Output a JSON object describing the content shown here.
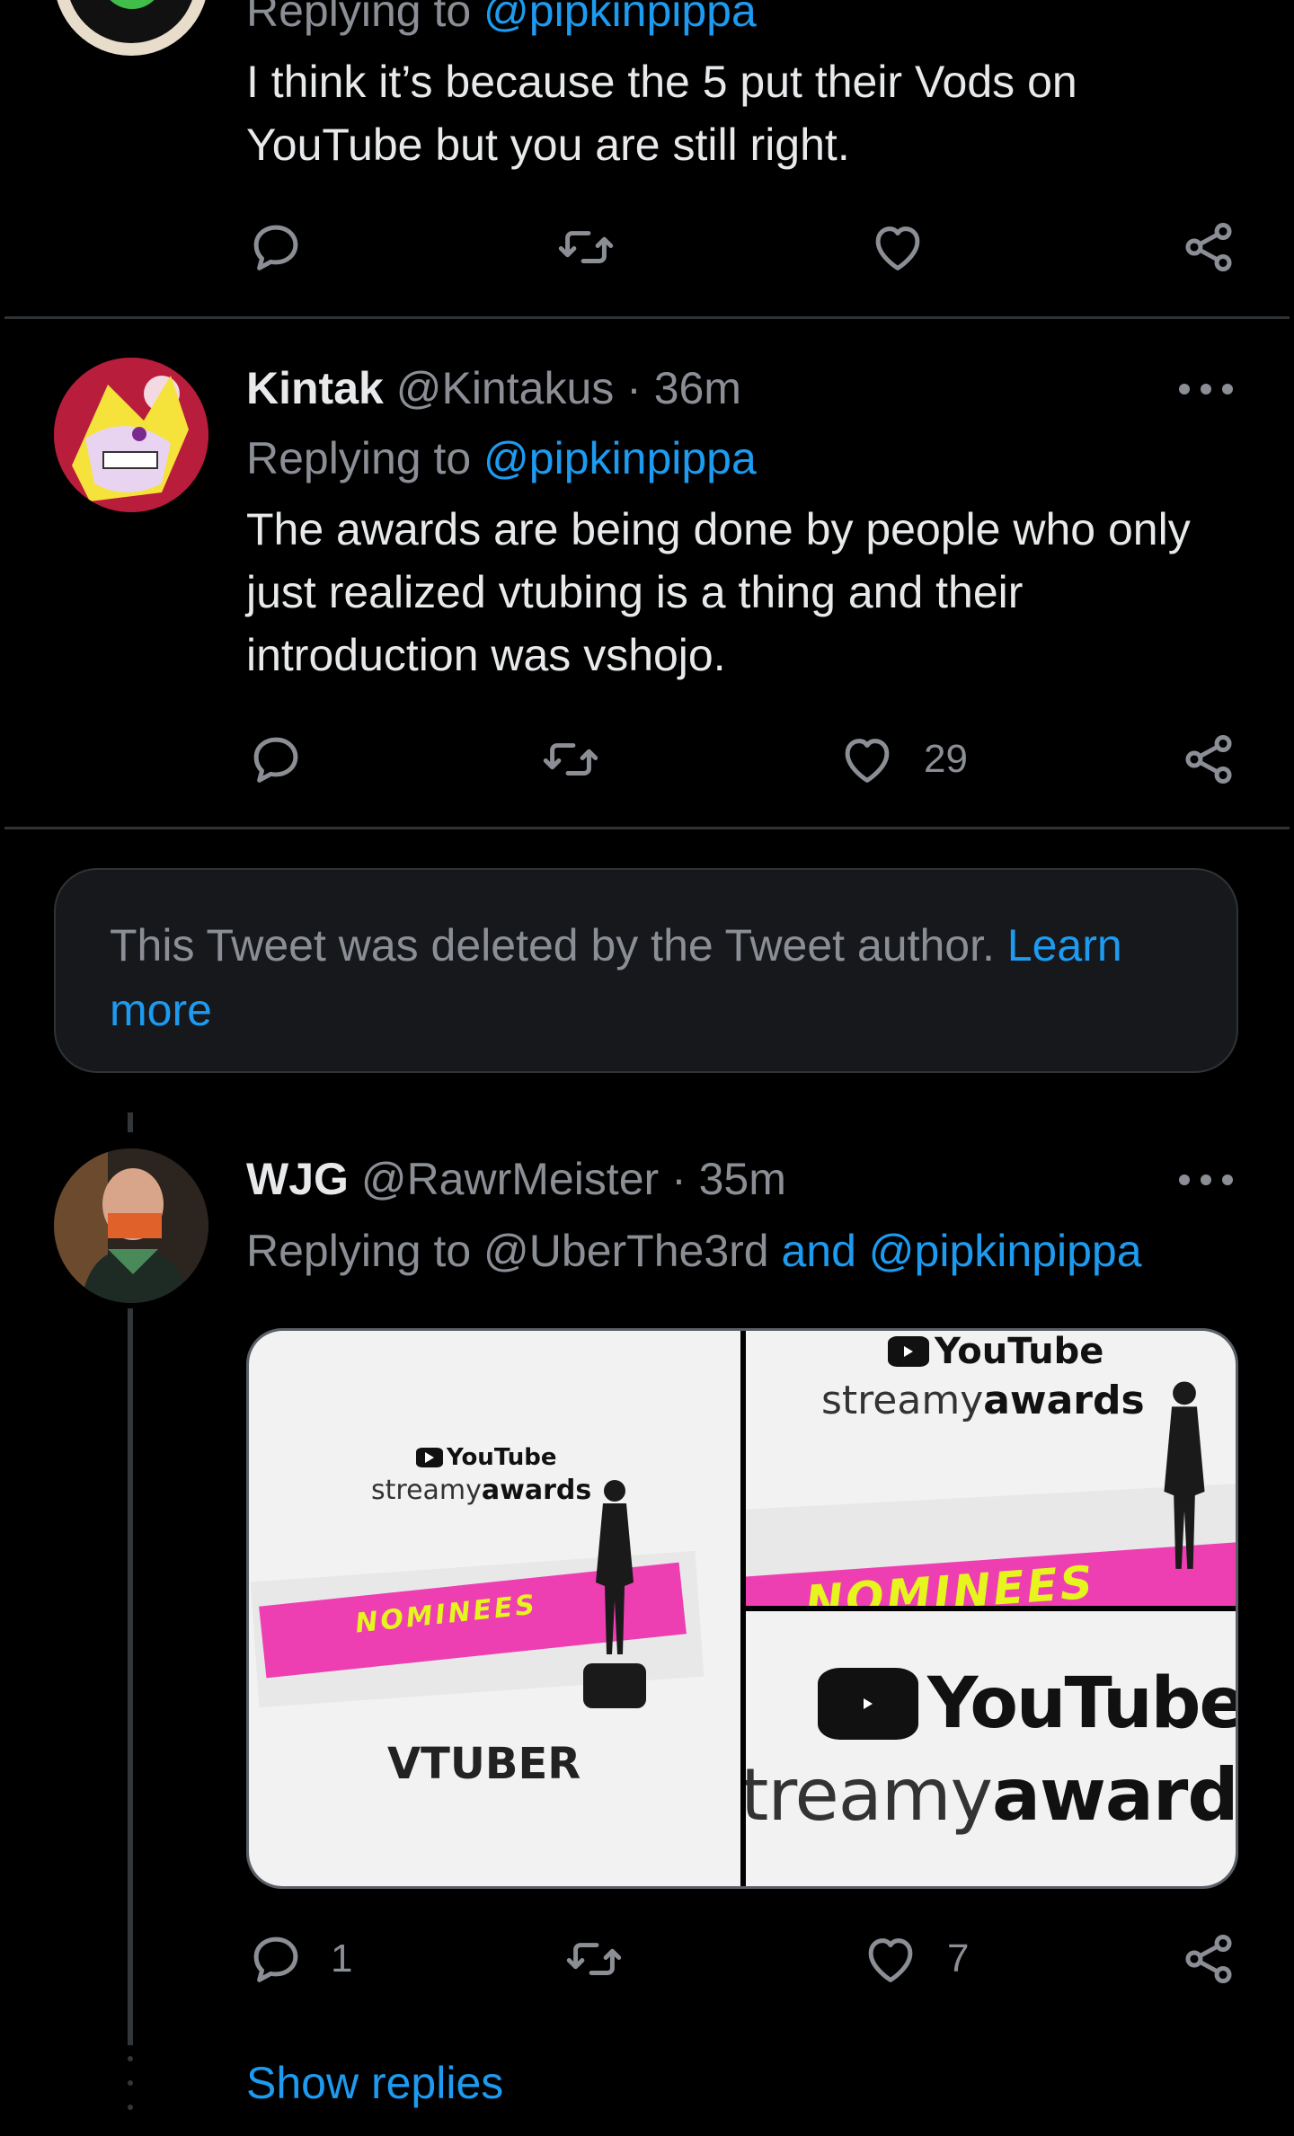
{
  "tweet1": {
    "reply_prefix": "Replying to ",
    "reply_to": "@pipkinpippa",
    "text": "I think it’s because the 5 put their Vods on YouTube but you are still right."
  },
  "tweet2": {
    "name": "Kintak",
    "handle": "@Kintakus",
    "separator": " · ",
    "time": "36m",
    "reply_prefix": "Replying to ",
    "reply_to": "@pipkinpippa",
    "text": "The awards are being done by people who only just realized vtubing is a thing and their introduction was vshojo.",
    "likes": "29"
  },
  "deleted": {
    "text": "This Tweet was deleted by the Tweet author. ",
    "link": "Learn more"
  },
  "tweet3": {
    "name": "WJG",
    "handle": "@RawrMeister",
    "separator": " · ",
    "time": "35m",
    "reply_prefix": "Replying to @UberThe3rd ",
    "reply_and": "and @pipkinpippa",
    "replies": "1",
    "likes": "7",
    "media": {
      "yt_label": "YouTube",
      "streamy_light": "streamy",
      "streamy_bold": "awards",
      "nominees": "NOMINEES",
      "category": "VTUBER",
      "streamy_cropped_light": "treamy",
      "streamy_cropped_bold": "awards"
    }
  },
  "show_replies": "Show replies",
  "icons": [
    "reply-icon",
    "retweet-icon",
    "like-icon",
    "share-icon",
    "more-icon"
  ],
  "colors": {
    "link": "#1d9bf0",
    "muted": "#8b8f95",
    "text": "#e7e9ea",
    "pink": "#ee3fb2",
    "yellow": "#e6f51d"
  }
}
